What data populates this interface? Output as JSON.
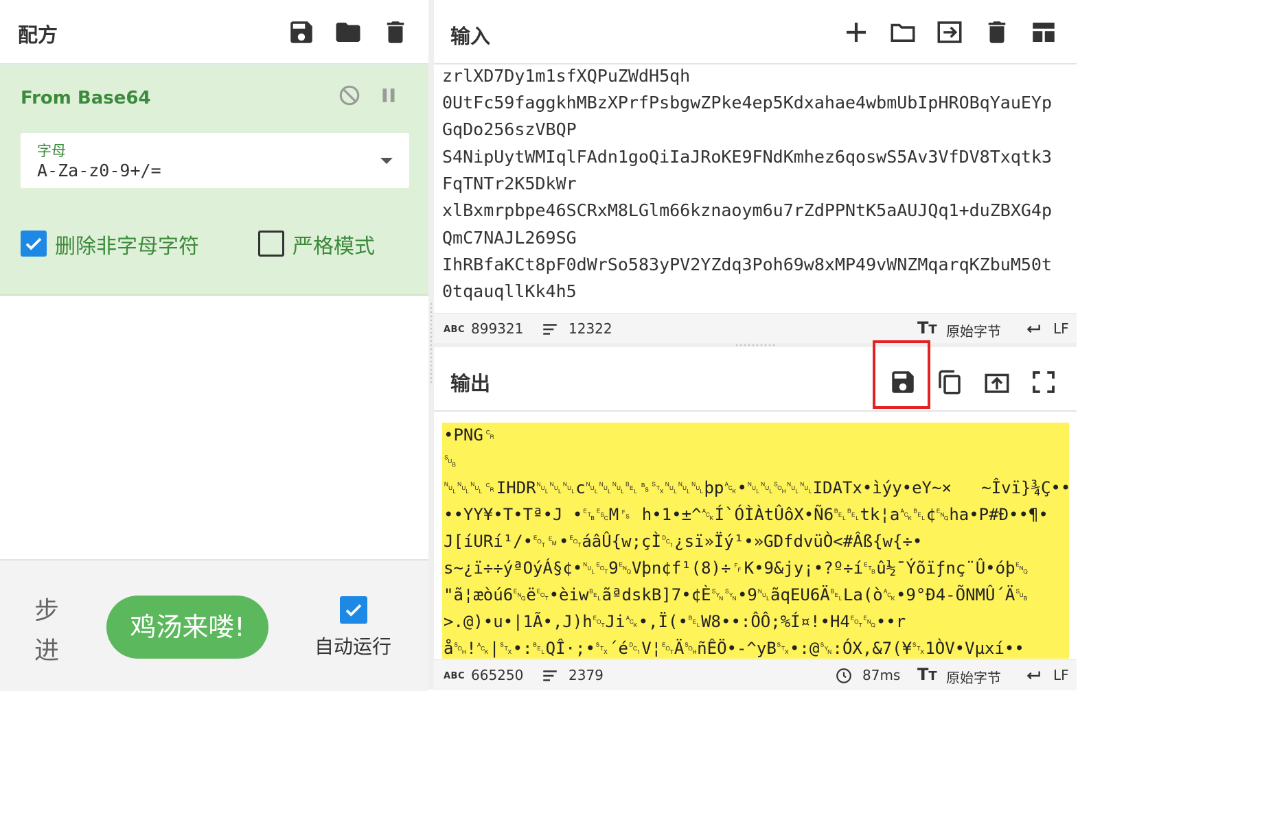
{
  "recipe": {
    "title": "配方",
    "icons": [
      "save-icon",
      "folder-icon",
      "trash-icon"
    ],
    "operation": {
      "name": "From Base64",
      "icons": [
        "disable-icon",
        "pause-icon"
      ],
      "alphabet_label": "字母",
      "alphabet_value": "A-Za-z0-9+/=",
      "remove_non_alpha": {
        "label": "删除非字母字符",
        "checked": true
      },
      "strict_mode": {
        "label": "严格模式",
        "checked": false
      }
    },
    "footer": {
      "step_label": "步进",
      "bake_label": "鸡汤来喽!",
      "auto_bake_label": "自动运行",
      "auto_bake_checked": true
    }
  },
  "input": {
    "title": "输入",
    "icons": [
      "add-icon",
      "folder-icon",
      "import-icon",
      "trash-icon",
      "layout-icon"
    ],
    "lines": [
      "zrlXD7Dy1m1sfXQPuZWdH5qh",
      "0UtFc59faggkhMBzXPrfPsbgwZPke4ep5Kdxahae4wbmUbIpHROBqYauEYp",
      "GqDo256szVBQP",
      "S4NipUytWMIqlFAdn1goQiIaJRoKE9FNdKmhez6qoswS5Av3VfDV8Txqtk3",
      "FqTNTr2K5DkWr",
      "xlBxmrpbpe46SCRxM8LGlm66kznaoym6u7rZdPPNtK5aAUJQq1+duZBXG4p",
      "QmC7NAJL269SG",
      "IhRBfaKCt8pF0dWrSo583yPV2YZdq3Poh69w8xMP49vWNZMqarqKZbuM50t",
      "0tqauqllKk4h5"
    ],
    "status": {
      "length_icon": "ABC",
      "length": "899321",
      "lines": "12322",
      "encoding": "原始字节",
      "eol": "LF"
    }
  },
  "output": {
    "title": "输出",
    "icons": [
      "save-icon",
      "copy-icon",
      "replace-input-icon",
      "maximise-icon"
    ],
    "lines": [
      "•PNG␍",
      "␚",
      "␀␀␀␍IHDR␀␀␀c␀␀␀␇␈␂␀␀␀þp␆•␀␀␁␀␀IDATx•ìýy•eY~×   ~Îvï}¾Ç••ûZ",
      "••YY¥•T•Tª•J •␗␛M␜ h•1•±^␆Í`ÓÌÀtÛôX•Ñ6␇␇tk¦a␆␇¢␅ha•P#Ð••¶•",
      "J[íURí¹/•␄␙•␄áâÛ{w;çÌ␑¿sï»Ïý¹•»GDfdvüÒ<#Âß{w{÷•",
      "s~¿ï÷÷ýªOýÁ§¢•␀␄9␅Vþn¢f¹(8)÷␌K•9&jy¡•?º÷í␗û½¯Ýõïƒnç¨Û•óþ␅",
      "\"ã¦æòú6␅ë␄•èiw␇ãªdskB]7•¢È␖␖•9␀ãqEU6Ä␇La(ò␆•9°Ð4-ÕNMÛ´Ä␚",
      ">.@)•u•|1Ã•,J)h␄Ji␆•,Ï(•␇W8••:ÔÔ;%Í¤!•H4␄␅••r",
      "å␁!␆|␂•:␇QÎ·;•␂´é␑V¦␄Ä␁ñÊÖ•-^yB␂•:@␖:ÓX,&7(¥␂1ÒV•Vµxí••"
    ],
    "status": {
      "length_icon": "ABC",
      "length": "665250",
      "lines": "2379",
      "time": "87ms",
      "encoding": "原始字节",
      "eol": "LF"
    }
  },
  "colors": {
    "accent_green": "#3c8a3c",
    "op_background": "#dff0d8",
    "bake_button": "#5cb85c",
    "checkbox_blue": "#1e88e5",
    "output_highlight": "#fff35a",
    "annotation_red": "#e32222"
  }
}
